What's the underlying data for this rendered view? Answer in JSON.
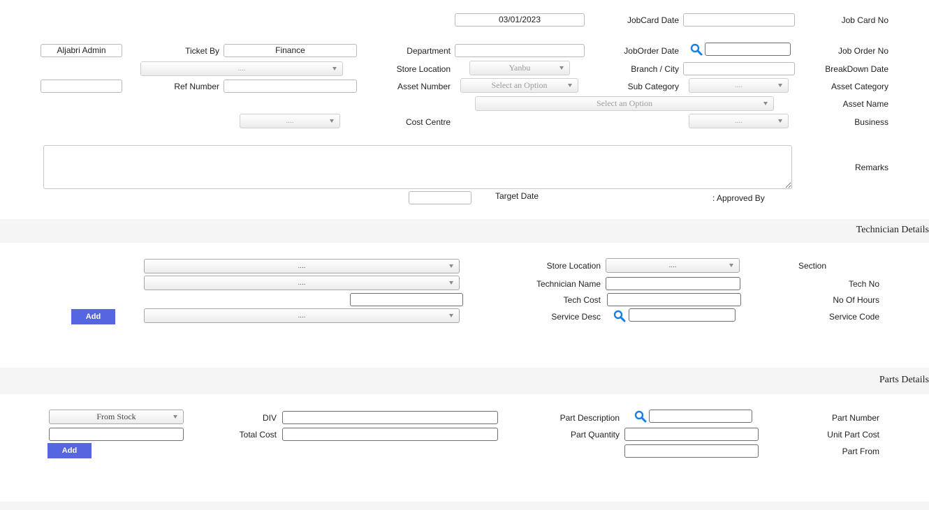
{
  "header": {
    "job_card_no_label": "Job Card No",
    "jobcard_date_label": "JobCard Date",
    "jobcard_date_value": "03/01/2023",
    "job_order_no_label": "Job Order No",
    "joborder_date_label": "JobOrder Date",
    "department_label": "Department",
    "ticket_by_label": "Ticket By",
    "ticket_by_value": "Finance",
    "user_value": "Aljabri Admin",
    "breakdown_date_label": "BreakDown Date",
    "branch_city_label": "Branch / City",
    "store_location_label": "Store Location",
    "store_location_value": "Yanbu",
    "top_select_value": "....",
    "asset_category_label": "Asset Category",
    "sub_category_label": "Sub Category",
    "sub_category_value": "....",
    "asset_number_label": "Asset Number",
    "asset_number_placeholder": "Select an Option",
    "ref_number_label": "Ref Number",
    "asset_name_label": "Asset Name",
    "asset_name_placeholder": "Select an Option",
    "business_label": "Business",
    "business_value": "....",
    "cost_centre_label": "Cost Centre",
    "cost_centre_value": "....",
    "remarks_label": "Remarks",
    "target_date_label": "Target Date",
    "approved_by_label": ": Approved By"
  },
  "technician": {
    "section_title": "Technician Details",
    "section_label": "Section",
    "store_location_label": "Store Location",
    "store_location_value": "....",
    "section_select_value": "....",
    "tech_no_label": "Tech No",
    "technician_name_label": "Technician Name",
    "tech_select_value": "....",
    "no_of_hours_label": "No Of Hours",
    "tech_cost_label": "Tech Cost",
    "service_code_label": "Service Code",
    "service_desc_label": "Service Desc",
    "service_select_value": "....",
    "add_label": "Add"
  },
  "parts": {
    "section_title": "Parts Details",
    "part_number_label": "Part Number",
    "part_description_label": "Part Description",
    "div_label": "DIV",
    "from_stock_value": "From Stock",
    "unit_part_cost_label": "Unit Part Cost",
    "part_quantity_label": "Part Quantity",
    "total_cost_label": "Total Cost",
    "part_from_label": "Part From",
    "add_label": "Add"
  },
  "colors": {
    "button": "#5566e0",
    "search_icon": "#1a7fe0",
    "band": "#f5f5f6"
  }
}
